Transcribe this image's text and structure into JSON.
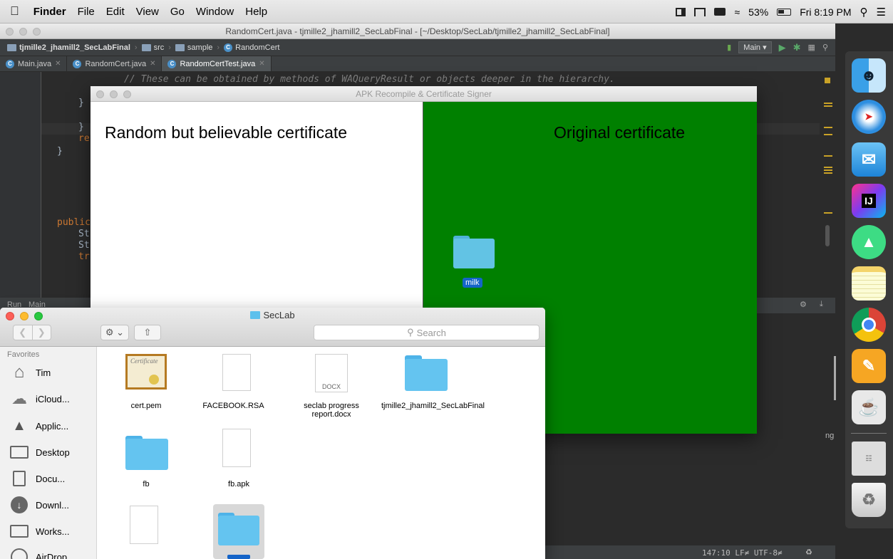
{
  "menubar": {
    "app": "Finder",
    "items": [
      "File",
      "Edit",
      "View",
      "Go",
      "Window",
      "Help"
    ],
    "battery": "53%",
    "clock": "Fri 8:19 PM"
  },
  "ide": {
    "title": "RandomCert.java - tjmille2_jhamill2_SecLabFinal - [~/Desktop/SecLab/tjmille2_jhamill2_SecLabFinal]",
    "breadcrumbs": [
      "tjmille2_jhamill2_SecLabFinal",
      "src",
      "sample",
      "RandomCert"
    ],
    "run_config": "Main",
    "tabs": [
      "Main.java",
      "RandomCert.java",
      "RandomCertTest.java"
    ],
    "code_comment": "// These can be obtained by methods of WAQueryResult or objects deeper in the hierarchy.",
    "code_brace1": "}",
    "code_brace2": "}",
    "code_re": "re",
    "code_brace3": "}",
    "code_public": "public",
    "code_st1": "St",
    "code_st2": "St",
    "code_tr": "tr",
    "run_tab": "Run",
    "run_label": "Main",
    "status": "147:10  LF≠  UTF-8≠",
    "side_text": "ng"
  },
  "apk_window": {
    "title": "APK Recompile & Certificate Signer",
    "left_label": "Random but believable certificate",
    "right_label": "Original certificate",
    "folder_label": "milk"
  },
  "finder": {
    "title": "SecLab",
    "search_placeholder": "Search",
    "sidebar_heading": "Favorites",
    "sidebar_items": [
      "Tim",
      "iCloud...",
      "Applic...",
      "Desktop",
      "Docu...",
      "Downl...",
      "Works...",
      "AirDrop"
    ],
    "files": [
      {
        "name": "cert.pem"
      },
      {
        "name": "FACEBOOK.RSA"
      },
      {
        "name": "seclab progress report.docx",
        "badge": "DOCX"
      },
      {
        "name": "tjmille2_jhamill2_SecLabFinal"
      },
      {
        "name": "fb"
      },
      {
        "name": "fb.apk"
      }
    ]
  },
  "colors": {
    "green_panel": "#008000",
    "folder_blue": "#5dc0ec",
    "ide_bg": "#2b2b2b"
  }
}
